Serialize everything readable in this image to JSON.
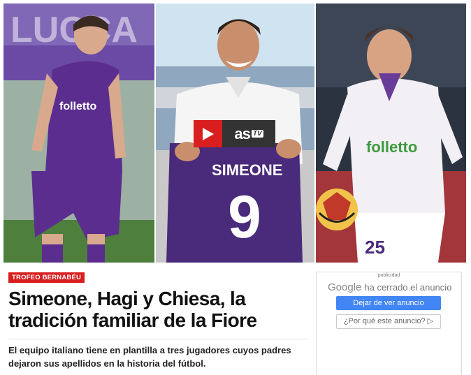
{
  "hero": {
    "jersey_sponsor_left": "folletto",
    "jersey_name": "SIMEONE",
    "jersey_number": "9",
    "jersey_sponsor_right": "folletto",
    "shorts_number": "25",
    "video_brand": "as",
    "video_brand_suffix": "TV"
  },
  "article": {
    "tag": "TROFEO BERNABÉU",
    "title": "Simeone, Hagi y Chiesa, la tradición familiar de la Fiore",
    "summary": "El equipo italiano tiene en plantilla a tres jugadores cuyos padres dejaron sus apellidos en la historia del fútbol."
  },
  "ad": {
    "label": "publicidad",
    "google": "Google",
    "closed_text": "ha cerrado el anuncio",
    "stop_button": "Dejar de ver anuncio",
    "why_button": "¿Por qué este anuncio? ▷"
  },
  "colors": {
    "brand_red": "#d81e1e",
    "fiorentina_purple": "#5b2d8e",
    "google_blue": "#4285f4"
  }
}
